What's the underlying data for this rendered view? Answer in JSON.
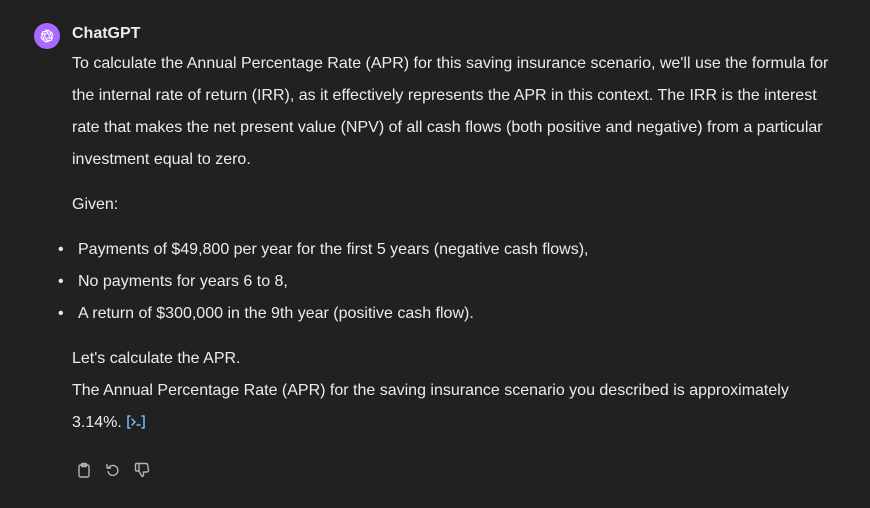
{
  "message": {
    "author": "ChatGPT",
    "avatar_icon": "openai-logo-icon",
    "avatar_color": "#ab68ff",
    "intro": "To calculate the Annual Percentage Rate (APR) for this saving insurance scenario, we'll use the formula for the internal rate of return (IRR), as it effectively represents the APR in this context. The IRR is the interest rate that makes the net present value (NPV) of all cash flows (both positive and negative) from a particular investment equal to zero.",
    "given_label": "Given:",
    "bullets": [
      "Payments of $49,800 per year for the first 5 years (negative cash flows),",
      "No payments for years 6 to 8,",
      "A return of $300,000 in the 9th year (positive cash flow)."
    ],
    "lets_calculate": "Let's calculate the APR.",
    "result": "The Annual Percentage Rate (APR) for the saving insurance scenario you described is approximately 3.14%.",
    "code_link_icon": "view-analysis-icon",
    "link_color": "#7ab7ff"
  },
  "actions": [
    {
      "name": "copy-button",
      "icon": "clipboard-icon"
    },
    {
      "name": "regenerate-button",
      "icon": "regenerate-icon"
    },
    {
      "name": "thumbs-down-button",
      "icon": "thumbs-down-icon"
    }
  ]
}
